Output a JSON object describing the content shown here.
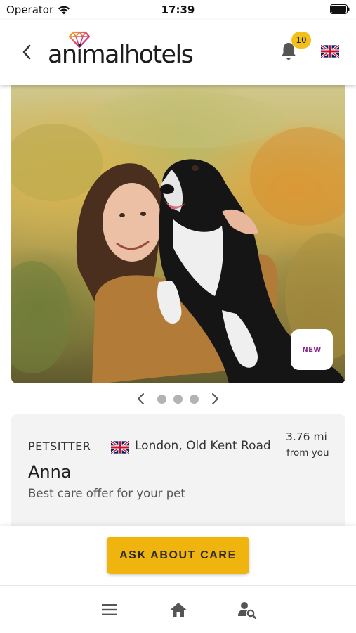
{
  "status_bar": {
    "carrier": "Operator",
    "time": "17:39"
  },
  "header": {
    "logo_text": "animalhotels",
    "notification_count": "10",
    "language": "English (UK)"
  },
  "hero": {
    "badge": "NEW",
    "carousel_pages": 3
  },
  "listing": {
    "role": "PETSITTER",
    "location": "London, Old Kent Road",
    "distance": "3.76 mi",
    "distance_suffix": "from you",
    "name": "Anna",
    "tagline": "Best care offer for your pet"
  },
  "actions": {
    "ask_label": "ASK ABOUT CARE"
  },
  "bottom_nav": {
    "items": [
      "menu-icon",
      "home-icon",
      "search-sitter-icon"
    ]
  },
  "colors": {
    "accent": "#f0b40f",
    "badge": "#f2c01a",
    "new_text": "#8a2d8a"
  }
}
